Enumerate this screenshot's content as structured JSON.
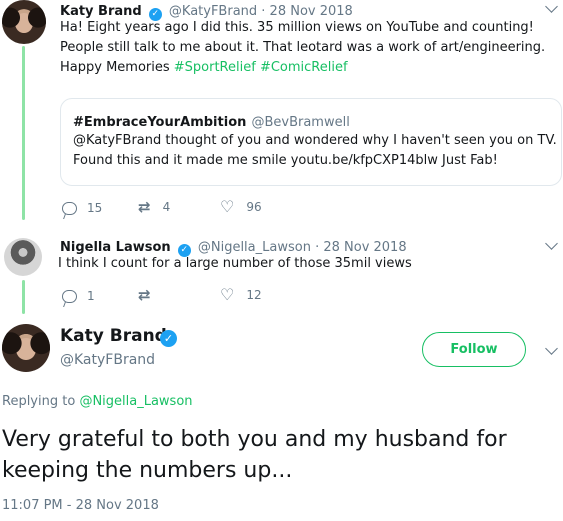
{
  "colors": {
    "accent": "#17bf63",
    "verified": "#1da1f2",
    "thread_line": "#8ee3a6",
    "muted": "#657786"
  },
  "tweet1": {
    "name": "Katy Brand",
    "handle_date": "@KatyFBrand · 28 Nov 2018",
    "line1": "Ha!  Eight years ago I did this.  35 million views on YouTube and counting!",
    "line2": "People still talk to me about it.  That leotard was a work of art/engineering.",
    "line3_prefix": "Happy Memories ",
    "tag1": "#SportRelief",
    "tag2": "#ComicRelief",
    "quote": {
      "name": "#EmbraceYourAmbition",
      "handle": "@BevBramwell",
      "line1": "@KatyFBrand thought of you and wondered why I haven't seen you on TV.",
      "line2": "Found this and it made me smile youtu.be/kfpCXP14blw Just Fab!"
    },
    "replies": "15",
    "retweets": "4",
    "likes": "96"
  },
  "tweet2": {
    "name": "Nigella Lawson",
    "handle_date": "@Nigella_Lawson · 28 Nov 2018",
    "text": "I think I count for a large number of those 35mil views",
    "replies": "1",
    "retweets": "",
    "likes": "12"
  },
  "main": {
    "name": "Katy Brand",
    "handle": "@KatyFBrand",
    "follow_label": "Follow",
    "replying_prefix": "Replying to ",
    "replying_handle": "@Nigella_Lawson",
    "text_line1": "Very grateful to both you and my husband for",
    "text_line2": "keeping the numbers up...",
    "timestamp": "11:07 PM - 28 Nov 2018"
  }
}
